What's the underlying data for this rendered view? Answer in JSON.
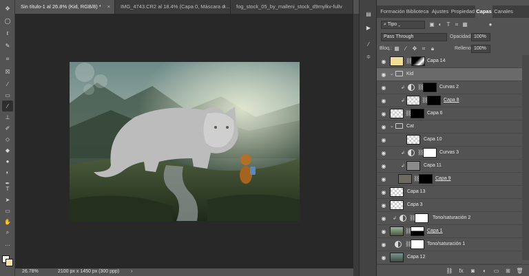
{
  "tabs": [
    {
      "label": "Sin título-1 al 26.8% (Kid, RGB/8) *",
      "active": true
    },
    {
      "label": "IMG_4743.CR2 al 18.4% (Capa 0, Máscara d…",
      "active": false
    },
    {
      "label": "fog_stock_05_by_malleni_stock_d9mylkv-fullv",
      "active": false
    }
  ],
  "tab_close": "×",
  "status": {
    "zoom": "26.78%",
    "doc_info": "2100 px x 1450 px (300 ppp)",
    "arrow": "›"
  },
  "panel_tabs": [
    "Formación",
    "Biblioteca",
    "Ajustes",
    "Propiedad",
    "Capas",
    "Canales"
  ],
  "controls": {
    "filter_kind": "Tipo",
    "blend_mode": "Pass Through",
    "opacity_label": "Opacidad:",
    "opacity_value": "100%",
    "lock_label": "Bloq.:",
    "fill_label": "Relleno:",
    "fill_value": "100%"
  },
  "layers": [
    {
      "name": "Capa 14",
      "kind": "fill",
      "thumb": "yellow"
    },
    {
      "name": "Kid",
      "kind": "group",
      "selected": true
    },
    {
      "name": "Curvas 2",
      "kind": "adjust",
      "clipped": true
    },
    {
      "name": "Capa 8",
      "kind": "masked",
      "clipped": true,
      "underline": true
    },
    {
      "name": "Capa 6",
      "kind": "masked"
    },
    {
      "name": "Cat",
      "kind": "group"
    },
    {
      "name": "Capa 10",
      "kind": "plain"
    },
    {
      "name": "Curvas 3",
      "kind": "adjust",
      "clipped": true
    },
    {
      "name": "Capa 11",
      "kind": "plain",
      "clipped": true
    },
    {
      "name": "Capa 9",
      "kind": "masked",
      "underline": true
    },
    {
      "name": "Capa 13",
      "kind": "plain"
    },
    {
      "name": "Capa 3",
      "kind": "plain"
    },
    {
      "name": "Tono/saturación 2",
      "kind": "adjust",
      "clipped": true
    },
    {
      "name": "Capa 1",
      "kind": "masked",
      "underline": true
    },
    {
      "name": "Tono/saturación 1",
      "kind": "adjust"
    },
    {
      "name": "Capa 12",
      "kind": "plain"
    }
  ],
  "colors": {
    "accent": "#6a6a6a",
    "bg": "#535353",
    "canvas": "#282828"
  }
}
